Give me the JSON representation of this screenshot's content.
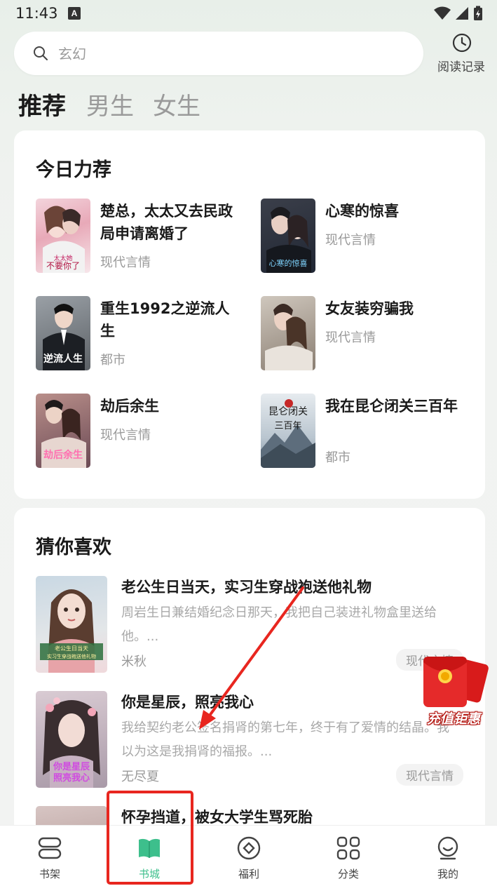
{
  "status_bar": {
    "time": "11:43",
    "notification_letter": "A"
  },
  "search": {
    "placeholder": "玄幻"
  },
  "history": {
    "label": "阅读记录"
  },
  "tabs": [
    {
      "label": "推荐",
      "active": true
    },
    {
      "label": "男生",
      "active": false
    },
    {
      "label": "女生",
      "active": false
    }
  ],
  "recommend": {
    "title": "今日力荐",
    "books": [
      {
        "title": "楚总，太太又去民政局申请离婚了",
        "genre": "现代言情",
        "cover_text": "太太她不要你了"
      },
      {
        "title": "心寒的惊喜",
        "genre": "现代言情",
        "cover_text": "心寒的惊喜"
      },
      {
        "title": "重生1992之逆流人生",
        "genre": "都市",
        "cover_text": "逆流人生"
      },
      {
        "title": "女友装穷骗我",
        "genre": "现代言情",
        "cover_text": ""
      },
      {
        "title": "劫后余生",
        "genre": "现代言情",
        "cover_text": "劫后余生"
      },
      {
        "title": "我在昆仑闭关三百年",
        "genre": "都市",
        "cover_text": "昆仑闭关三百年"
      }
    ]
  },
  "guess": {
    "title": "猜你喜欢",
    "books": [
      {
        "title": "老公生日当天，实习生穿战袍送他礼物",
        "desc": "周岩生日兼结婚纪念日那天，我把自己装进礼物盒里送给他。...",
        "author": "米秋",
        "tag": "现代言情",
        "cover_text": "老公生日当天"
      },
      {
        "title": "你是星辰，照亮我心",
        "desc": "我给契约老公签名捐肾的第七年，终于有了爱情的结晶。我以为这是我捐肾的福报。...",
        "author": "无尽夏",
        "tag": "现代言情",
        "cover_text": "你是星辰照亮我心"
      },
      {
        "title": "怀孕挡道，被女大学生骂死胎",
        "desc": "",
        "author": "",
        "tag": "",
        "cover_text": ""
      }
    ]
  },
  "promo": {
    "label": "充值钜惠"
  },
  "nav": [
    {
      "label": "书架",
      "icon": "bookshelf-icon",
      "active": false
    },
    {
      "label": "书城",
      "icon": "book-open-icon",
      "active": true
    },
    {
      "label": "福利",
      "icon": "diamond-icon",
      "active": false
    },
    {
      "label": "分类",
      "icon": "grid-icon",
      "active": false
    },
    {
      "label": "我的",
      "icon": "smile-icon",
      "active": false
    }
  ],
  "colors": {
    "accent": "#3dbf8c",
    "annotation": "#e8261f",
    "page_bg": "#f2f3f2"
  }
}
